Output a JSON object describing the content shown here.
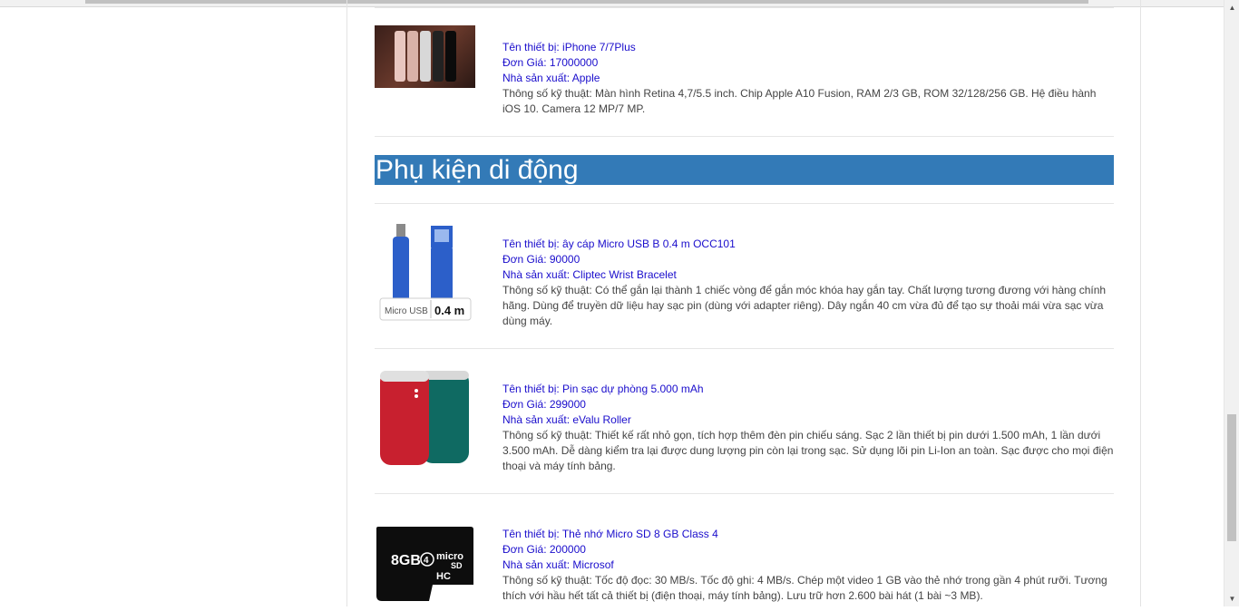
{
  "page": {
    "bg": "#ffffff",
    "accent": "#337ab7",
    "link_color": "#1a0dcc"
  },
  "section": {
    "title": "Phụ kiện di động"
  },
  "products": [
    {
      "name": "Tên thiết bị: iPhone 7/7Plus",
      "price": "Đơn Giá: 17000000",
      "maker": "Nhà sản xuất: Apple",
      "spec": "Thông số kỹ thuật: Màn hình Retina 4,7/5.5 inch. Chip Apple A10 Fusion, RAM 2/3 GB, ROM 32/128/256 GB. Hệ điều hành iOS 10. Camera 12 MP/7 MP."
    },
    {
      "name": "Tên thiết bị: ây cáp Micro USB B 0.4 m OCC101",
      "price": "Đơn Giá: 90000",
      "maker": "Nhà sản xuất: Cliptec Wrist Bracelet",
      "spec": "Thông số kỹ thuật: Có thể gắn lại thành 1 chiếc vòng để gắn móc khóa hay gắn tay. Chất lượng tương đương với hàng chính hãng. Dùng để truyền dữ liệu hay sạc pin (dùng với adapter riêng). Dây ngắn 40 cm vừa đủ để tạo sự thoải mái vừa sạc vừa dùng máy.",
      "image_text": [
        "Micro USB",
        "0.4 m"
      ]
    },
    {
      "name": "Tên thiết bị: Pin sạc dự phòng 5.000 mAh",
      "price": "Đơn Giá: 299000",
      "maker": "Nhà sản xuất: eValu Roller",
      "spec": "Thông số kỹ thuật: Thiết kế rất nhỏ gọn, tích hợp thêm đèn pin chiếu sáng. Sạc 2 lần thiết bị pin dưới 1.500 mAh, 1 lần dưới 3.500 mAh. Dễ dàng kiểm tra lại được dung lượng pin còn lại trong sạc. Sử dụng lõi pin Li-Ion an toàn. Sạc được cho mọi điện thoại và máy tính bảng."
    },
    {
      "name": "Tên thiết bị: Thẻ nhớ Micro SD 8 GB Class 4",
      "price": "Đơn Giá: 200000",
      "maker": "Nhà sản xuất: Microsof",
      "spec": "Thông số kỹ thuật: Tốc độ đọc: 30 MB/s. Tốc độ ghi: 4 MB/s. Chép một video 1 GB vào thẻ nhớ trong gần 4 phút rưỡi. Tương thích với hầu hết tất cả thiết bị (điện thoại, máy tính bảng). Lưu trữ hơn 2.600 bài hát (1 bài ~3 MB).",
      "image_text": [
        "8GB",
        "4",
        "micro",
        "SD",
        "HC"
      ]
    }
  ]
}
